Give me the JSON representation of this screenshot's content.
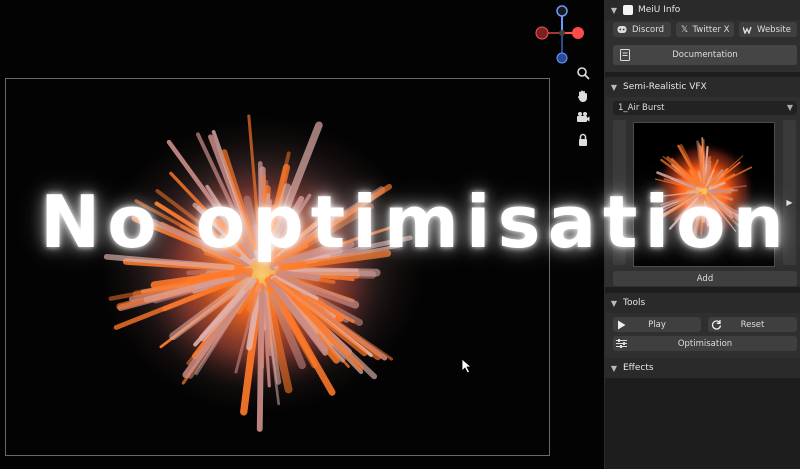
{
  "overlay": {
    "caption": "No optimisation"
  },
  "meiu_info": {
    "header": "MeiU Info",
    "links": [
      {
        "label": "Discord",
        "icon": "discord-icon"
      },
      {
        "label": "Twitter X",
        "icon": "x-icon"
      },
      {
        "label": "Website",
        "icon": "website-icon"
      }
    ],
    "documentation_label": "Documentation"
  },
  "semi_realistic_vfx": {
    "header": "Semi-Realistic VFX",
    "selected_effect": "1_Air Burst",
    "add_label": "Add"
  },
  "tools": {
    "header": "Tools",
    "play_label": "Play",
    "reset_label": "Reset",
    "optimisation_label": "Optimisation"
  },
  "effects": {
    "header": "Effects"
  },
  "viewport_tools": [
    "zoom-icon",
    "hand-icon",
    "camera-icon",
    "lock-icon"
  ],
  "colors": {
    "panel_bg": "#2f2f2f",
    "button_bg": "#3f3f3f",
    "fire": "#ff6a1a",
    "glow": "#ffffff"
  }
}
